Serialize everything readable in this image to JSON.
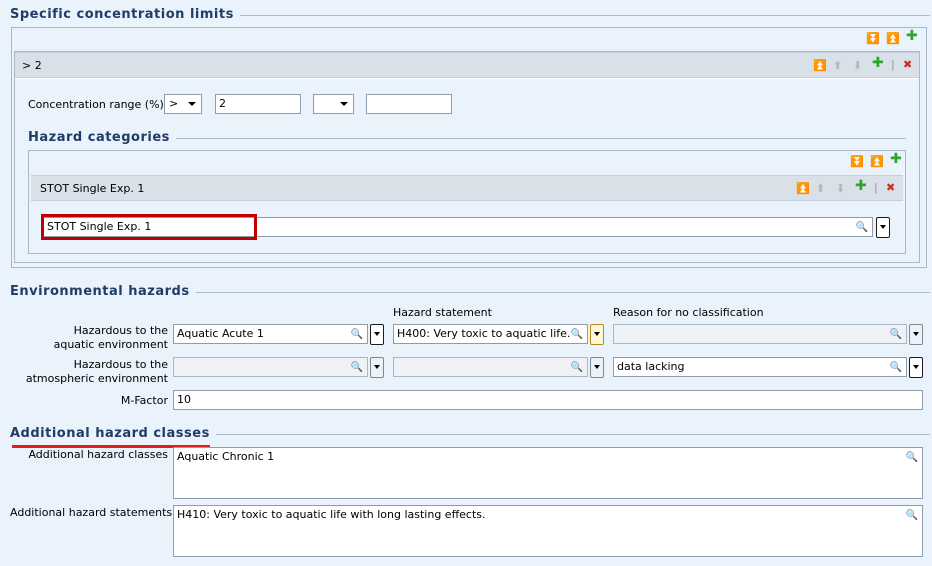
{
  "specific_concentration_limits": {
    "title": "Specific concentration limits",
    "entry_title": "> 2",
    "concentration_range_label": "Concentration range (%)",
    "operator1": ">",
    "value1": "2",
    "operator2": "",
    "value2": "",
    "hazard_categories": {
      "title": "Hazard categories",
      "entry_title": "STOT Single Exp. 1",
      "value": "STOT Single Exp. 1"
    }
  },
  "environmental_hazards": {
    "title": "Environmental hazards",
    "col_hazard_statement": "Hazard statement",
    "col_reason": "Reason for no classification",
    "aquatic_label_line1": "Hazardous to the",
    "aquatic_label_line2": "aquatic environment",
    "aquatic_class": "Aquatic Acute 1",
    "aquatic_statement": "H400: Very toxic to aquatic life.",
    "aquatic_reason": "",
    "atmos_label_line1": "Hazardous to the",
    "atmos_label_line2": "atmospheric environment",
    "atmos_class": "",
    "atmos_statement": "",
    "atmos_reason": "data lacking",
    "mfactor_label": "M-Factor",
    "mfactor_value": "10"
  },
  "additional_hazard_classes": {
    "title": "Additional hazard classes",
    "classes_label": "Additional hazard classes",
    "classes_value": "Aquatic Chronic 1",
    "statements_label": "Additional hazard statements",
    "statements_value": "H410: Very toxic to aquatic life with long lasting effects."
  },
  "colors": {
    "highlight": "#c00000",
    "underline": "#e21b1b",
    "title": "#1f3d66"
  }
}
